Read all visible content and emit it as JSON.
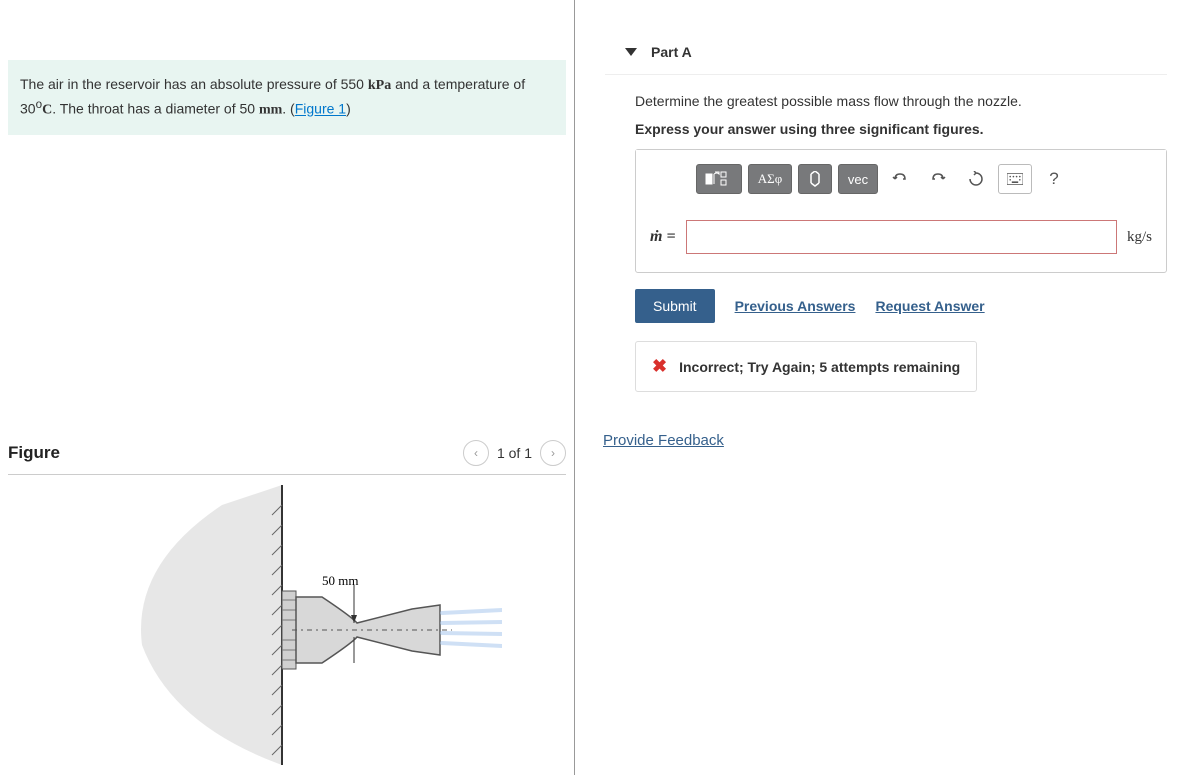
{
  "problem": {
    "text_before_pressure": "The air in the reservoir has an absolute pressure of 550 ",
    "pressure_unit": "kPa",
    "text_mid": " and a temperature of 30",
    "degree": "o",
    "temp_unit": "C",
    "text_after_temp": ". The throat has a diameter of 50 ",
    "diameter_unit": "mm",
    "text_end": ". (",
    "figure_link": "Figure 1",
    "close_paren": ")"
  },
  "figure": {
    "title": "Figure",
    "count": "1 of 1",
    "throat_label": "50 mm"
  },
  "part": {
    "label": "Part A",
    "prompt": "Determine the greatest possible mass flow through the nozzle.",
    "instruction": "Express your answer using three significant figures.",
    "variable": "ṁ =",
    "unit": "kg/s",
    "submit": "Submit",
    "previous": "Previous Answers",
    "request": "Request Answer",
    "feedback": "Incorrect; Try Again; 5 attempts remaining"
  },
  "toolbar": {
    "greek": "ΑΣφ",
    "vec": "vec",
    "help": "?"
  },
  "links": {
    "provide_feedback": "Provide Feedback"
  }
}
